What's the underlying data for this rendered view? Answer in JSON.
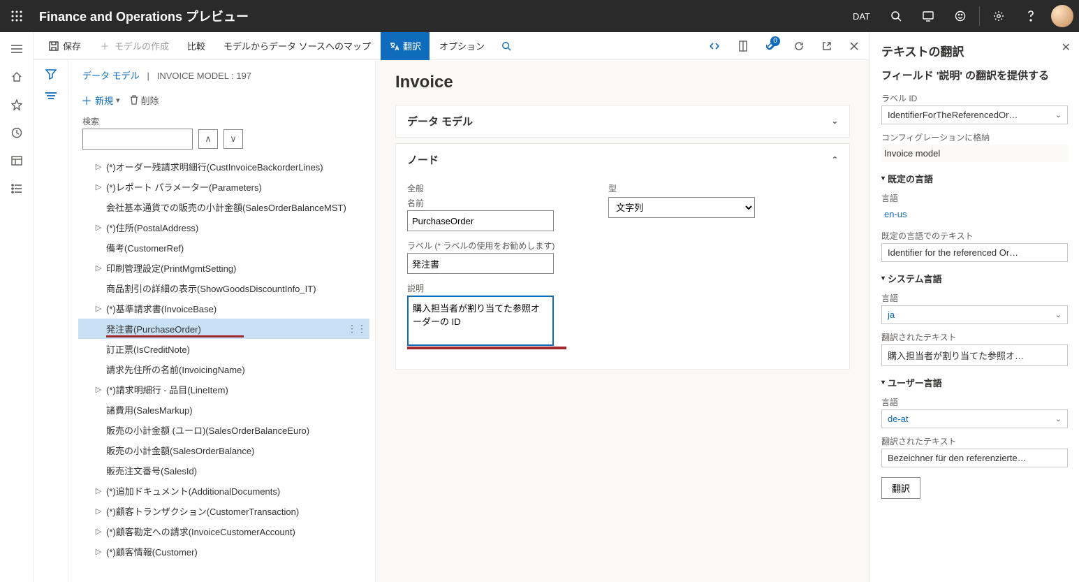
{
  "top": {
    "title": "Finance and Operations プレビュー",
    "company": "DAT"
  },
  "cmdbar": {
    "save": "保存",
    "create_model": "モデルの作成",
    "compare": "比較",
    "map_to_ds": "モデルからデータ ソースへのマップ",
    "translate": "翻訳",
    "options": "オプション",
    "badge_count": "0"
  },
  "breadcrumb": {
    "root": "データ モデル",
    "sep": "|",
    "model": "INVOICE MODEL : 197"
  },
  "tree_toolbar": {
    "new": "新規",
    "delete": "削除"
  },
  "search": {
    "label": "検索"
  },
  "tree": [
    {
      "expand": true,
      "label": "(*)オーダー残請求明細行(CustInvoiceBackorderLines)"
    },
    {
      "expand": true,
      "label": "(*)レポート パラメーター(Parameters)"
    },
    {
      "expand": false,
      "label": "会社基本通貨での販売の小計金額(SalesOrderBalanceMST)"
    },
    {
      "expand": true,
      "label": "(*)住所(PostalAddress)"
    },
    {
      "expand": false,
      "label": "備考(CustomerRef)"
    },
    {
      "expand": true,
      "label": "印刷管理設定(PrintMgmtSetting)"
    },
    {
      "expand": false,
      "label": "商品割引の詳細の表示(ShowGoodsDiscountInfo_IT)"
    },
    {
      "expand": true,
      "label": "(*)基準請求書(InvoiceBase)"
    },
    {
      "expand": false,
      "label": "発注書(PurchaseOrder)",
      "selected": true
    },
    {
      "expand": false,
      "label": "訂正票(IsCreditNote)"
    },
    {
      "expand": false,
      "label": "請求先住所の名前(InvoicingName)"
    },
    {
      "expand": true,
      "label": "(*)請求明細行 - 品目(LineItem)"
    },
    {
      "expand": false,
      "label": "諸費用(SalesMarkup)"
    },
    {
      "expand": false,
      "label": "販売の小計金額 (ユーロ)(SalesOrderBalanceEuro)"
    },
    {
      "expand": false,
      "label": "販売の小計金額(SalesOrderBalance)"
    },
    {
      "expand": false,
      "label": "販売注文番号(SalesId)"
    },
    {
      "expand": true,
      "label": "(*)追加ドキュメント(AdditionalDocuments)"
    },
    {
      "expand": true,
      "label": "(*)顧客トランザクション(CustomerTransaction)"
    },
    {
      "expand": true,
      "label": "(*)顧客勘定への請求(InvoiceCustomerAccount)"
    },
    {
      "expand": true,
      "label": "(*)顧客情報(Customer)"
    }
  ],
  "detail": {
    "heading": "Invoice",
    "data_model_card": "データ モデル",
    "node_card": "ノード",
    "general": "全般",
    "name_label": "名前",
    "name_value": "PurchaseOrder",
    "label_label": "ラベル (* ラベルの使用をお勧めします)",
    "label_value": "発注書",
    "desc_label": "説明",
    "desc_value": "購入担当者が割り当てた参照オーダーの ID",
    "type_label": "型",
    "type_value": "文字列"
  },
  "trans": {
    "title": "テキストの翻訳",
    "subtitle": "フィールド '説明' の翻訳を提供する",
    "labelid_label": "ラベル ID",
    "labelid_value": "IdentifierForTheReferencedOr…",
    "stored_label": "コンフィグレーションに格納",
    "stored_value": "Invoice model",
    "default_section": "既定の言語",
    "lang_label": "言語",
    "default_lang": "en-us",
    "default_text_label": "既定の言語でのテキスト",
    "default_text": "Identifier for the referenced Or…",
    "system_section": "システム言語",
    "system_lang": "ja",
    "translated_label": "翻訳されたテキスト",
    "system_text": "購入担当者が割り当てた参照オ…",
    "user_section": "ユーザー言語",
    "user_lang": "de-at",
    "user_text": "Bezeichner für den referenzierte…",
    "translate_btn": "翻訳"
  }
}
